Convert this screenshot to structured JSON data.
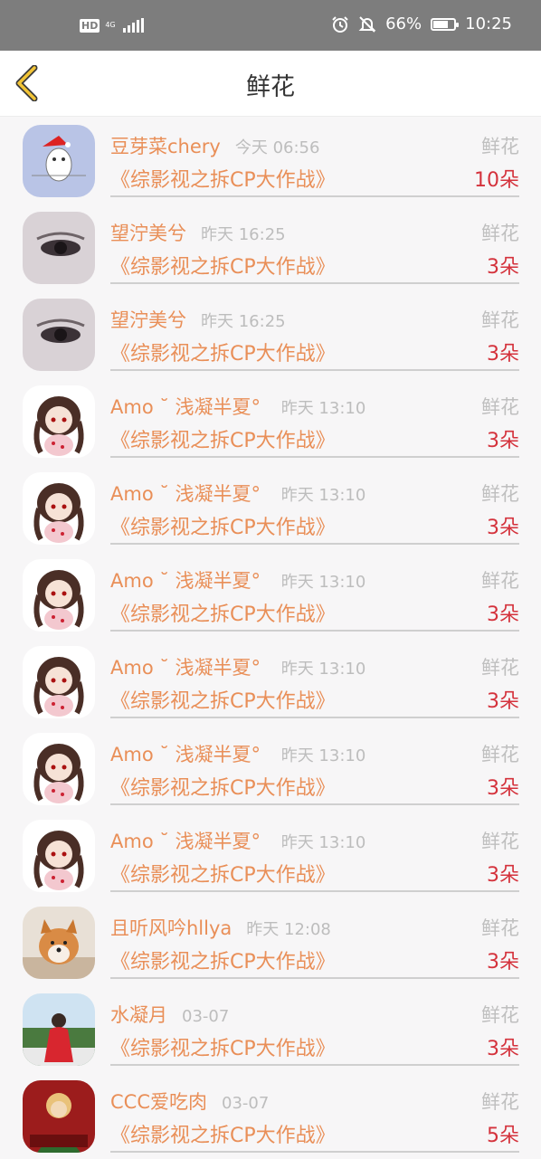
{
  "status_bar": {
    "hd": "HD",
    "network": "4G",
    "battery": "66%",
    "time": "10:25"
  },
  "header": {
    "title": "鲜花"
  },
  "rows": [
    {
      "name": "豆芽菜chery",
      "time": "今天 06:56",
      "gift": "鲜花",
      "work": "《综影视之拆CP大作战》",
      "count": "10朵"
    },
    {
      "name": "望泞美兮",
      "time": "昨天 16:25",
      "gift": "鲜花",
      "work": "《综影视之拆CP大作战》",
      "count": "3朵"
    },
    {
      "name": "望泞美兮",
      "time": "昨天 16:25",
      "gift": "鲜花",
      "work": "《综影视之拆CP大作战》",
      "count": "3朵"
    },
    {
      "name": "Amo ˘ 浅凝半夏° ",
      "time": "昨天 13:10",
      "gift": "鲜花",
      "work": "《综影视之拆CP大作战》",
      "count": "3朵"
    },
    {
      "name": "Amo ˘ 浅凝半夏° ",
      "time": "昨天 13:10",
      "gift": "鲜花",
      "work": "《综影视之拆CP大作战》",
      "count": "3朵"
    },
    {
      "name": "Amo ˘ 浅凝半夏° ",
      "time": "昨天 13:10",
      "gift": "鲜花",
      "work": "《综影视之拆CP大作战》",
      "count": "3朵"
    },
    {
      "name": "Amo ˘ 浅凝半夏° ",
      "time": "昨天 13:10",
      "gift": "鲜花",
      "work": "《综影视之拆CP大作战》",
      "count": "3朵"
    },
    {
      "name": "Amo ˘ 浅凝半夏° ",
      "time": "昨天 13:10",
      "gift": "鲜花",
      "work": "《综影视之拆CP大作战》",
      "count": "3朵"
    },
    {
      "name": "Amo ˘ 浅凝半夏° ",
      "time": "昨天 13:10",
      "gift": "鲜花",
      "work": "《综影视之拆CP大作战》",
      "count": "3朵"
    },
    {
      "name": "且听风吟hllya",
      "time": "昨天 12:08",
      "gift": "鲜花",
      "work": "《综影视之拆CP大作战》",
      "count": "3朵"
    },
    {
      "name": "水凝月",
      "time": "03-07",
      "gift": "鲜花",
      "work": "《综影视之拆CP大作战》",
      "count": "3朵"
    },
    {
      "name": "CCC爱吃肉",
      "time": "03-07",
      "gift": "鲜花",
      "work": "《综影视之拆CP大作战》",
      "count": "5朵"
    }
  ]
}
